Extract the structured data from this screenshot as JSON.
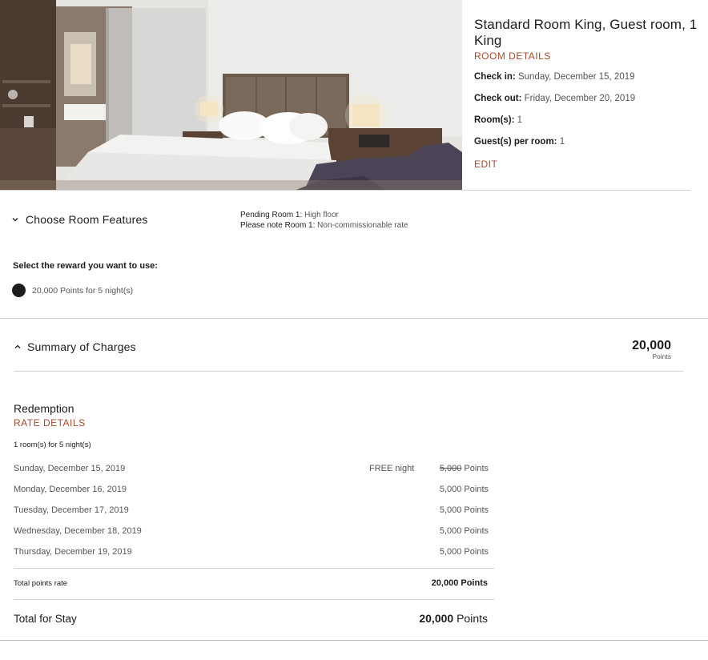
{
  "room": {
    "title": "Standard Room King, Guest room, 1 King",
    "details_link": "ROOM DETAILS",
    "check_in_label": "Check in:",
    "check_in_value": "Sunday, December 15, 2019",
    "check_out_label": "Check out:",
    "check_out_value": "Friday, December 20, 2019",
    "rooms_label": "Room(s):",
    "rooms_value": "1",
    "guests_label": "Guest(s) per room:",
    "guests_value": "1",
    "edit_link": "EDIT"
  },
  "features": {
    "title": "Choose Room Features",
    "pending_label": "Pending Room 1:",
    "pending_value": "High floor",
    "note_label": "Please note Room 1:",
    "note_value": "Non-commissionable rate",
    "reward_label": "Select the reward you want to use:",
    "reward_option": "20,000 Points for 5 night(s)"
  },
  "summary": {
    "title": "Summary of Charges",
    "total_points": "20,000",
    "total_unit": "Points",
    "redemption_title": "Redemption",
    "rate_details_link": "RATE DETAILS",
    "nights_note": "1 room(s) for 5 night(s)",
    "nights": [
      {
        "date": "Sunday, December 15, 2019",
        "free": "FREE night",
        "points": "5,000",
        "unit": "Points",
        "struck": true
      },
      {
        "date": "Monday, December 16, 2019",
        "free": "",
        "points": "5,000",
        "unit": "Points",
        "struck": false
      },
      {
        "date": "Tuesday, December 17, 2019",
        "free": "",
        "points": "5,000",
        "unit": "Points",
        "struck": false
      },
      {
        "date": "Wednesday, December 18, 2019",
        "free": "",
        "points": "5,000",
        "unit": "Points",
        "struck": false
      },
      {
        "date": "Thursday, December 19, 2019",
        "free": "",
        "points": "5,000",
        "unit": "Points",
        "struck": false
      }
    ],
    "total_rate_label": "Total points rate",
    "total_rate_value": "20,000 Points",
    "stay_label": "Total for Stay",
    "stay_points": "20,000",
    "stay_unit": "Points"
  },
  "colors": {
    "accent": "#a44a2d",
    "text": "#1c1c1c",
    "muted": "#555555",
    "rule": "#d3d3d3"
  },
  "icons": {
    "features_toggle": "chevron-down-icon",
    "summary_toggle": "chevron-up-icon",
    "reward_radio": "radio-selected-icon"
  }
}
